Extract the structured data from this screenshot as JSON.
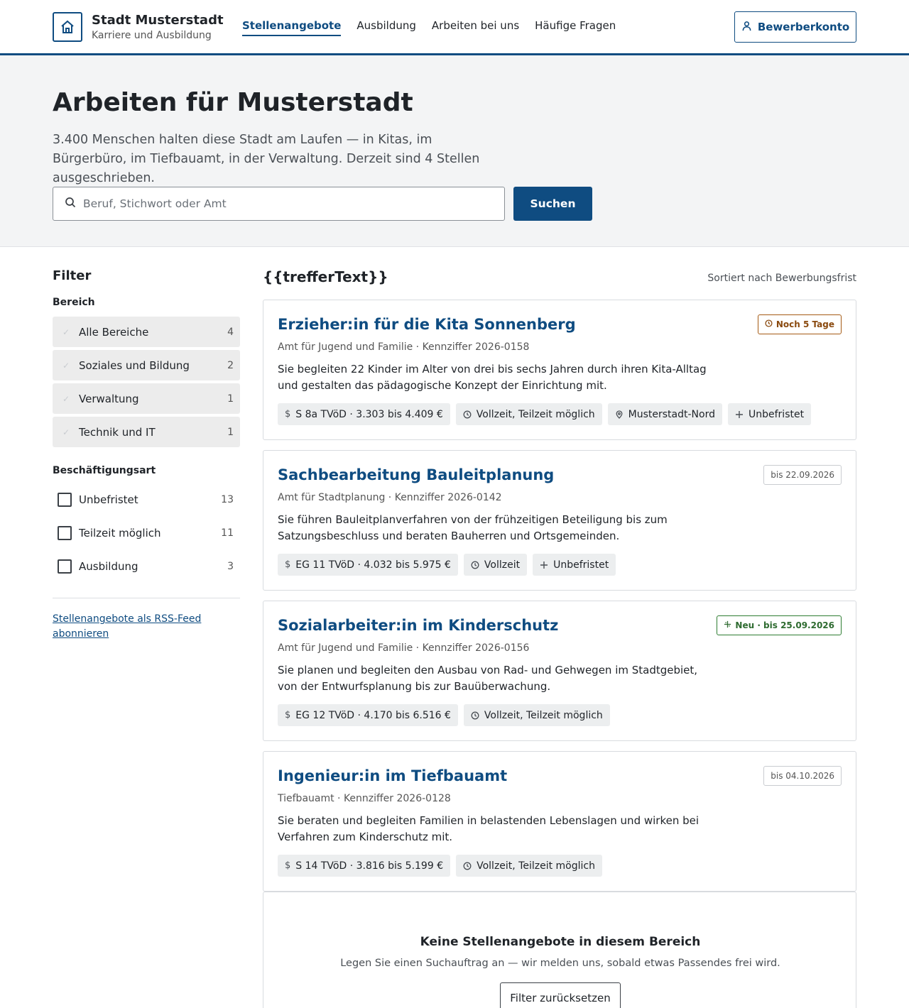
{
  "header": {
    "brand_title": "Stadt Musterstadt",
    "brand_subtitle": "Karriere und Ausbildung",
    "nav": [
      {
        "label": "Stellenangebote",
        "active": true
      },
      {
        "label": "Ausbildung",
        "active": false
      },
      {
        "label": "Arbeiten bei uns",
        "active": false
      },
      {
        "label": "Häufige Fragen",
        "active": false
      }
    ],
    "account_label": "Bewerberkonto"
  },
  "hero": {
    "title": "Arbeiten für Musterstadt",
    "text": "3.400 Menschen halten diese Stadt am Laufen — in Kitas, im Bürgerbüro, im Tiefbauamt, in der Verwaltung. Derzeit sind 4 Stellen ausgeschrieben.",
    "search_placeholder": "Beruf, Stichwort oder Amt",
    "search_value": "",
    "search_button": "Suchen"
  },
  "sidebar": {
    "title": "Filter",
    "area_label": "Bereich",
    "areas": [
      {
        "label": "Alle Bereiche",
        "count": "4"
      },
      {
        "label": "Soziales und Bildung",
        "count": "2"
      },
      {
        "label": "Verwaltung",
        "count": "1"
      },
      {
        "label": "Technik und IT",
        "count": "1"
      }
    ],
    "employment_label": "Beschäftigungsart",
    "employment": [
      {
        "label": "Unbefristet",
        "count": "13"
      },
      {
        "label": "Teilzeit möglich",
        "count": "11"
      },
      {
        "label": "Ausbildung",
        "count": "3"
      }
    ],
    "rss_link": "Stellenangebote als RSS-Feed abonnieren"
  },
  "results": {
    "title": "{{trefferText}}",
    "sort_text": "Sortiert nach Bewerbungsfrist",
    "jobs": [
      {
        "title": "Erzieher:in für die Kita Sonnenberg",
        "meta": "Amt für Jugend und Familie · Kennziffer 2026-0158",
        "description": "Sie begleiten 22 Kinder im Alter von drei bis sechs Jahren durch ihren Kita-Alltag und gestalten das pädagogische Konzept der Einrichtung mit.",
        "badge": "Noch 5 Tage",
        "chips": [
          "S 8a TVöD · 3.303 bis 4.409 €",
          "Vollzeit, Teilzeit möglich",
          "Musterstadt-Nord",
          "Unbefristet"
        ]
      },
      {
        "title": "Sachbearbeitung Bauleitplanung",
        "meta": "Amt für Stadtplanung · Kennziffer 2026-0142",
        "description": "Sie führen Bauleitplanverfahren von der frühzeitigen Beteiligung bis zum Satzungsbeschluss und beraten Bauherren und Ortsgemeinden.",
        "badge": "bis 22.09.2026",
        "chips": [
          "EG 11 TVöD · 4.032 bis 5.975 €",
          "Vollzeit",
          "Unbefristet"
        ]
      },
      {
        "title": "Sozialarbeiter:in im Kinderschutz",
        "meta": "Amt für Jugend und Familie · Kennziffer 2026-0156",
        "description": "Sie planen und begleiten den Ausbau von Rad- und Gehwegen im Stadtgebiet, von der Entwurfsplanung bis zur Bauüberwachung.",
        "badge": "Neu · bis 25.09.2026",
        "chips": [
          "EG 12 TVöD · 4.170 bis 6.516 €",
          "Vollzeit, Teilzeit möglich"
        ]
      },
      {
        "title": "Ingenieur:in im Tiefbauamt",
        "meta": "Tiefbauamt · Kennziffer 2026-0128",
        "description": "Sie beraten und begleiten Familien in belastenden Lebenslagen und wirken bei Verfahren zum Kinderschutz mit.",
        "badge": "bis 04.10.2026",
        "chips": [
          "S 14 TVöD · 3.816 bis 5.199 €",
          "Vollzeit, Teilzeit möglich"
        ]
      }
    ],
    "empty_title": "Keine Stellenangebote in diesem Bereich",
    "empty_text": "Legen Sie einen Suchauftrag an — wir melden uns, sobald etwas Passendes frei wird.",
    "reset_button": "Filter zurücksetzen"
  },
  "colors": {
    "primary": "#0f4c81",
    "warning": "#a55a14",
    "success": "#2e7d32"
  }
}
